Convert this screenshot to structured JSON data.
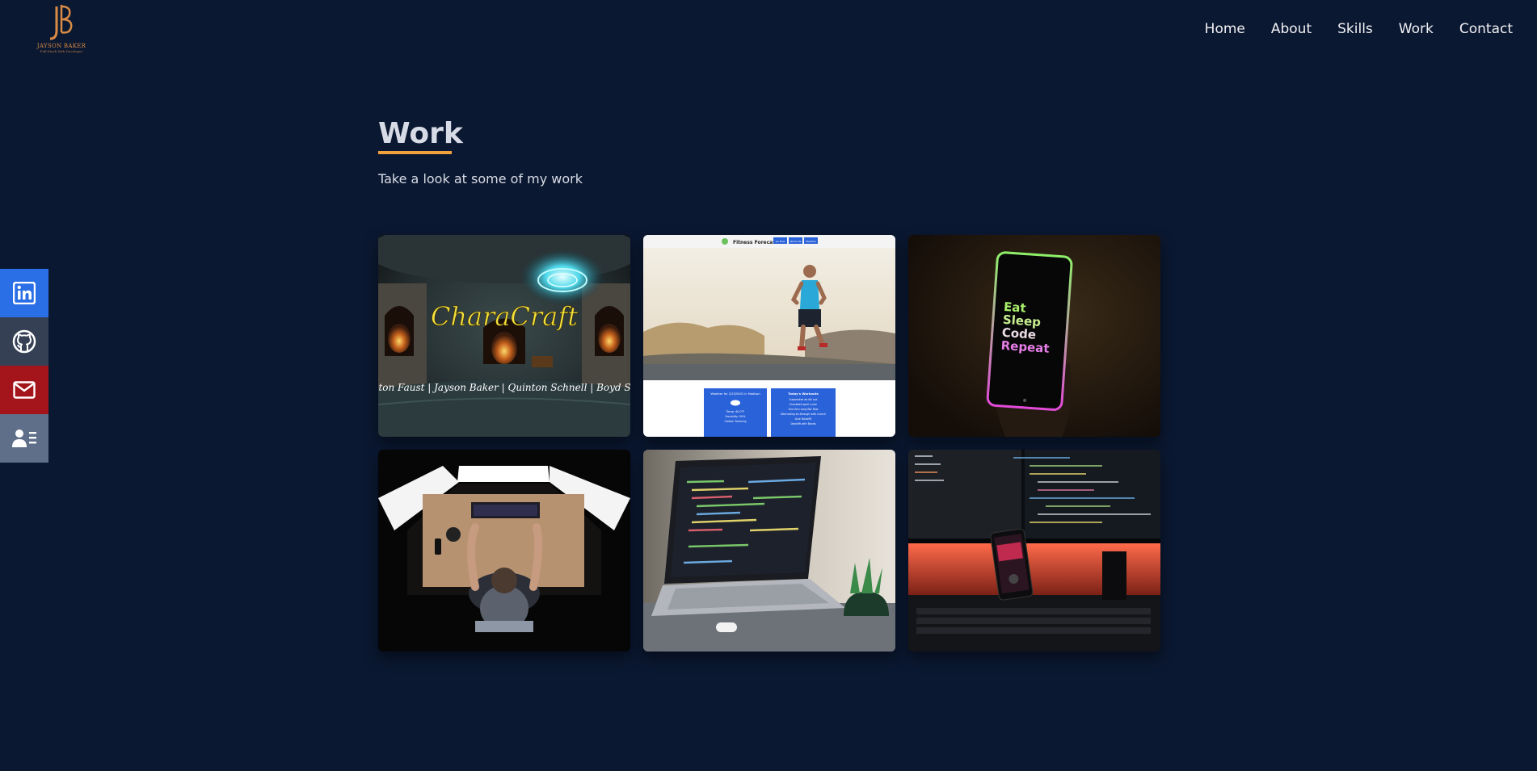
{
  "logo": {
    "monogram": "JB",
    "name": "JAYSON BAKER",
    "tagline": "Full-Stack Web Developer"
  },
  "nav": {
    "items": [
      "Home",
      "About",
      "Skills",
      "Work",
      "Contact"
    ]
  },
  "social": [
    {
      "name": "linkedin",
      "icon": "linkedin-icon",
      "color": "#2b6fe6"
    },
    {
      "name": "github",
      "icon": "github-icon",
      "color": "#354055"
    },
    {
      "name": "email",
      "icon": "envelope-icon",
      "color": "#a3151a"
    },
    {
      "name": "resume",
      "icon": "contact-card-icon",
      "color": "#5f6f8a"
    }
  ],
  "work": {
    "title": "Work",
    "subtitle": "Take a look at some of my work",
    "projects": [
      {
        "image_text": "CharaCraft",
        "image_credits": "Preston Faust | Jayson Baker | Quinton Schnell | Boyd Stack"
      },
      {
        "image_header": "Fitness Forecast",
        "image_buttons": [
          "Go Now",
          "Workouts",
          "Weather"
        ],
        "image_weather": "Weather for 2/23/5401 in Madison",
        "image_weather_detail": [
          "Temp: 40.0°F",
          "Humidity: 50%",
          "Cardio: Running"
        ],
        "image_workouts_title": "Today's Workouts",
        "image_workouts": [
          "Suspended ab fall out",
          "Dumbbell spell curve",
          "One Arm Long Bar Row",
          "Alternating sit-through with crunch",
          "Axle Deadlift",
          "Deadlift with Bands"
        ]
      },
      {
        "image_text_lines": [
          "Eat",
          "Sleep",
          "Code",
          "Repeat"
        ]
      },
      {},
      {},
      {}
    ]
  },
  "colors": {
    "background": "#0b1831",
    "accent": "#f0a03c",
    "linkedin": "#2b6fe6",
    "github": "#354055",
    "email": "#a3151a",
    "resume": "#5f6f8a"
  }
}
